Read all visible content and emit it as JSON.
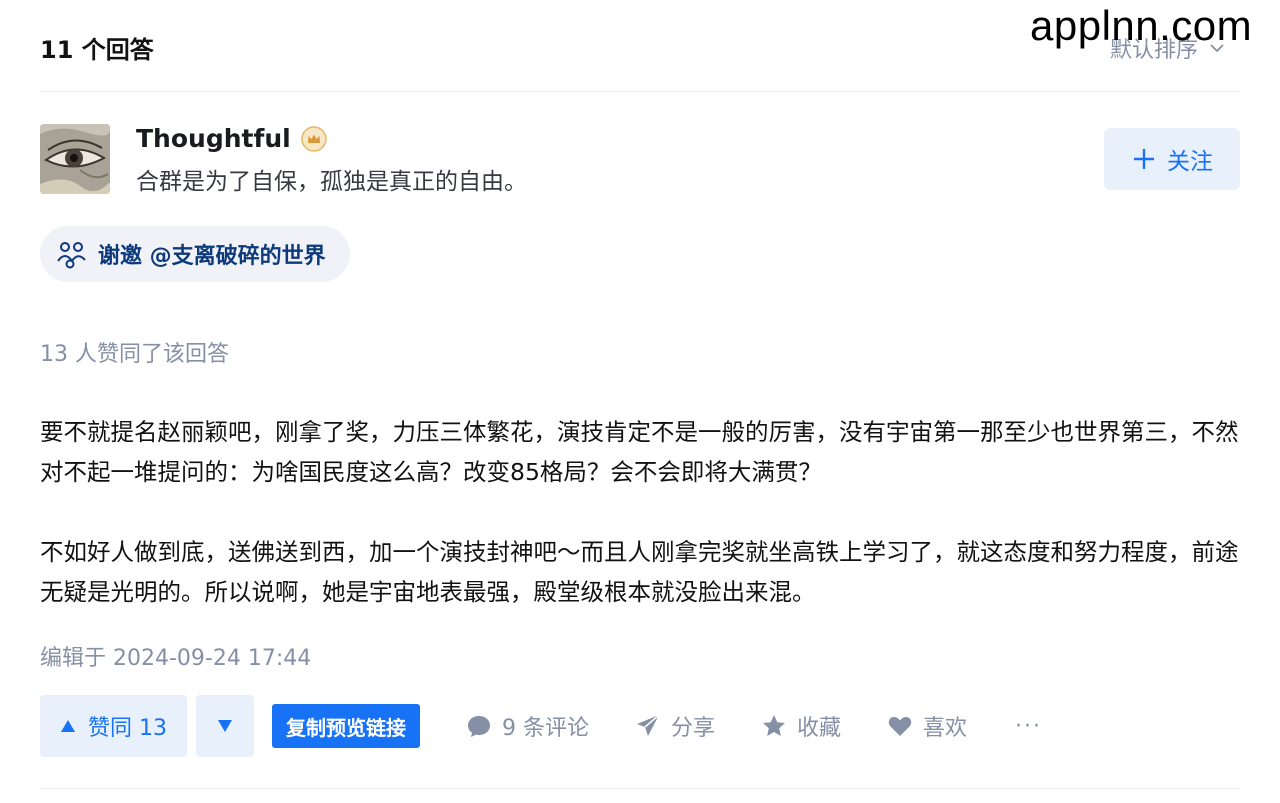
{
  "header": {
    "answer_count": "11 个回答",
    "sort_label": "默认排序"
  },
  "watermark": "applnn.com",
  "author": {
    "name": "Thoughtful",
    "bio": "合群是为了自保，孤独是真正的自由。",
    "follow_label": "关注"
  },
  "invite": {
    "text": "谢邀 @支离破碎的世界"
  },
  "votes_line": "13 人赞同了该回答",
  "content": {
    "paragraphs": [
      "要不就提名赵丽颖吧，刚拿了奖，力压三体繁花，演技肯定不是一般的厉害，没有宇宙第一那至少也世界第三，不然对不起一堆提问的：为啥国民度这么高？改变85格局？会不会即将大满贯？",
      "不如好人做到底，送佛送到西，加一个演技封神吧～而且人刚拿完奖就坐高铁上学习了，就这态度和努力程度，前途无疑是光明的。所以说啊，她是宇宙地表最强，殿堂级根本就没脸出来混。"
    ]
  },
  "edited": "编辑于 2024-09-24 17:44",
  "actions": {
    "vote_up_label": "赞同 13",
    "copy_link_label": "复制预览链接",
    "comments_label": "9 条评论",
    "share_label": "分享",
    "collect_label": "收藏",
    "like_label": "喜欢",
    "more_label": "···"
  },
  "colors": {
    "accent": "#1772f6",
    "accent_bg": "#e8f0fc",
    "muted": "#8590a6",
    "invite_text": "#0d3a7a"
  }
}
